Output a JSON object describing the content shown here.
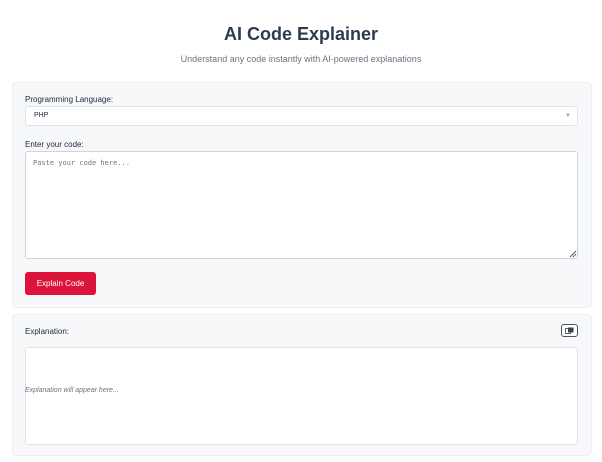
{
  "header": {
    "title": "AI Code Explainer",
    "subtitle": "Understand any code instantly with AI-powered explanations"
  },
  "form": {
    "language_label": "Programming Language:",
    "language_selected": "PHP",
    "code_label": "Enter your code:",
    "code_placeholder": "Paste your code here...",
    "submit_label": "Explain Code"
  },
  "output": {
    "label": "Explanation:",
    "placeholder": "Explanation will appear here...",
    "copy_icon": "copy-icon"
  },
  "colors": {
    "accent": "#dc143c",
    "title": "#2d3b4f",
    "panel": "#f7f8fa"
  }
}
